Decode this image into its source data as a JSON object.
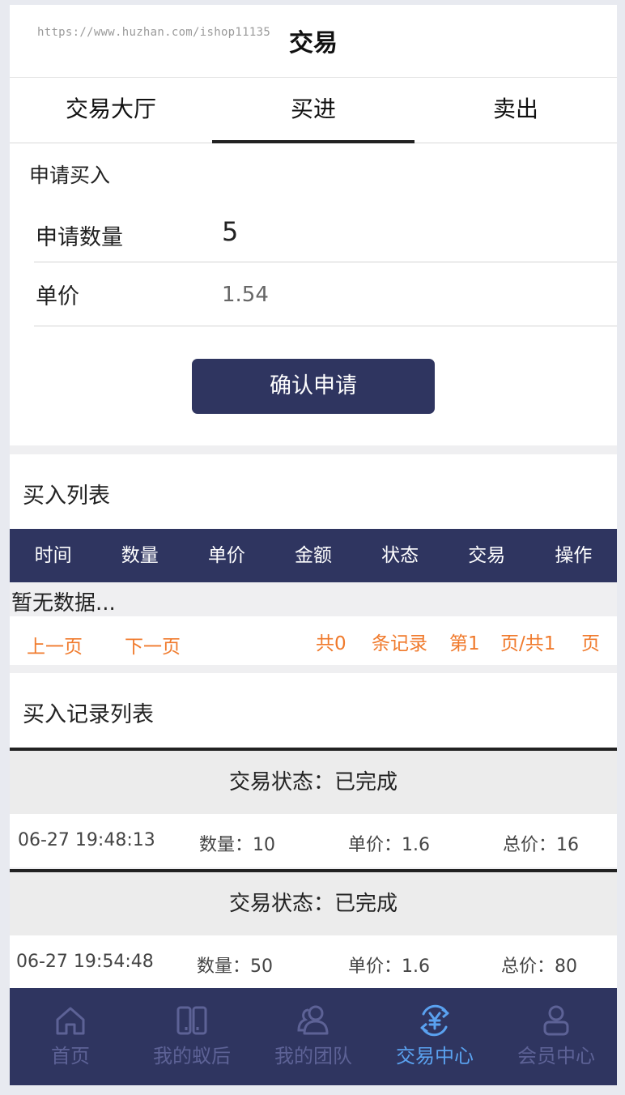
{
  "header": {
    "watermark": "https://www.huzhan.com/ishop11135",
    "title": "交易"
  },
  "tabs": [
    {
      "label": "交易大厅",
      "active": false
    },
    {
      "label": "买进",
      "active": true
    },
    {
      "label": "卖出",
      "active": false
    }
  ],
  "form": {
    "title": "申请买入",
    "quantity_label": "申请数量",
    "quantity_value": "5",
    "price_label": "单价",
    "price_value": "1.54",
    "confirm_label": "确认申请"
  },
  "buy_list": {
    "title": "买入列表",
    "columns": [
      "时间",
      "数量",
      "单价",
      "金额",
      "状态",
      "交易",
      "操作"
    ],
    "empty_text": "暂无数据..."
  },
  "pager": {
    "prev": "上一页",
    "next": "下一页",
    "total_prefix": "共0",
    "total_suffix": "条记录",
    "page_prefix": "第1",
    "page_mid": "页/共1",
    "page_suffix": "页"
  },
  "records": {
    "title": "买入记录列表",
    "items": [
      {
        "status": "交易状态：已完成",
        "time": "06-27 19:48:13",
        "qty": "数量：10",
        "price": "单价：1.6",
        "total": "总价：16"
      },
      {
        "status": "交易状态：已完成",
        "time": "06-27 19:54:48",
        "qty": "数量：50",
        "price": "单价：1.6",
        "total": "总价：80"
      }
    ]
  },
  "nav": [
    {
      "label": "首页",
      "icon": "home-icon",
      "active": false
    },
    {
      "label": "我的蚁后",
      "icon": "book-icon",
      "active": false
    },
    {
      "label": "我的团队",
      "icon": "team-icon",
      "active": false
    },
    {
      "label": "交易中心",
      "icon": "yuan-exchange-icon",
      "active": true
    },
    {
      "label": "会员中心",
      "icon": "user-icon",
      "active": false
    }
  ],
  "colors": {
    "primary": "#2f3560",
    "pager_text": "#f07a2c",
    "nav_active": "#5aa2f0",
    "nav_inactive": "#5d6296"
  }
}
